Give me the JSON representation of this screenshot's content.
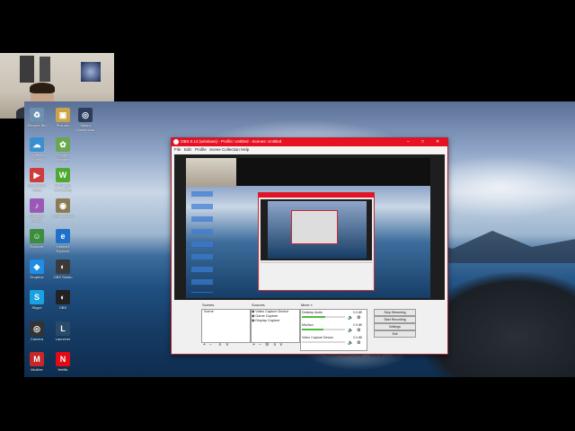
{
  "webcam": {
    "label": ""
  },
  "desktop_icons": [
    {
      "label": "Recycle Bin",
      "color": "#6d8fb0",
      "glyph": "♻"
    },
    {
      "label": "Pictures",
      "color": "#c9a44a",
      "glyph": "▣"
    },
    {
      "label": "Steam Downloads",
      "color": "#2b3d5a",
      "glyph": "◎"
    },
    {
      "label": "Connected Video",
      "color": "#3a8fd0",
      "glyph": "☁"
    },
    {
      "label": "Program Manager",
      "color": "#6aa84f",
      "glyph": "✿"
    },
    {
      "label": "Screenshot Video",
      "color": "#d03b3b",
      "glyph": "▶"
    },
    {
      "label": "W Pinged Connected",
      "color": "#4ea832",
      "glyph": "W"
    },
    {
      "label": "Windows Media",
      "color": "#9b59b6",
      "glyph": "♪"
    },
    {
      "label": "Ventrilo Audio",
      "color": "#8a7a55",
      "glyph": "◉"
    },
    {
      "label": "Explorer",
      "color": "#3c8d3c",
      "glyph": "☺"
    },
    {
      "label": "Internet Explorer",
      "color": "#1e70c9",
      "glyph": "e"
    },
    {
      "label": "Dropbox",
      "color": "#1f8ce6",
      "glyph": "◆"
    },
    {
      "label": "OBS Studio",
      "color": "#3a3a3a",
      "glyph": "◐"
    },
    {
      "label": "Skype",
      "color": "#1aa1e2",
      "glyph": "S"
    },
    {
      "label": "OBS",
      "color": "#222",
      "glyph": "◐"
    },
    {
      "label": "Camera",
      "color": "#333",
      "glyph": "◎"
    },
    {
      "label": "Launcher",
      "color": "#2a4a6a",
      "glyph": "L"
    },
    {
      "label": "McAfee",
      "color": "#c62828",
      "glyph": "M"
    },
    {
      "label": "Netflix",
      "color": "#e50914",
      "glyph": "N"
    }
  ],
  "obs": {
    "title": "OBS 0.13 (windows) - Profile: Untitled - Scenes: Untitled",
    "menu": [
      "File",
      "Edit",
      "Profile",
      "Scene Collection",
      "Help"
    ],
    "scenes": {
      "label": "Scenes",
      "items": [
        "Scene"
      ]
    },
    "sources": {
      "label": "Sources",
      "items": [
        "Video Capture Device",
        "Game Capture",
        "Display Capture"
      ]
    },
    "mixer": {
      "label": "Mixer",
      "channels": [
        {
          "name": "Desktop Audio",
          "db": "0.0 dB",
          "level": 0.55
        },
        {
          "name": "Mic/Aux",
          "db": "0.0 dB",
          "level": 0.5
        },
        {
          "name": "Video Capture Device",
          "db": "0.0 dB",
          "level": 0.0
        }
      ]
    },
    "controls": [
      "Stop Streaming",
      "Start Recording",
      "Settings",
      "Exit"
    ],
    "status": {
      "dropped": "Dropped Frames 0 (0.0%)",
      "time": "00:00:28",
      "cpu": "CPU: 6.8%",
      "kbps": "kb/s: 2579"
    },
    "toolbar": {
      "add": "+",
      "remove": "−",
      "up": "∧",
      "down": "∨",
      "gear": "⚙"
    }
  }
}
